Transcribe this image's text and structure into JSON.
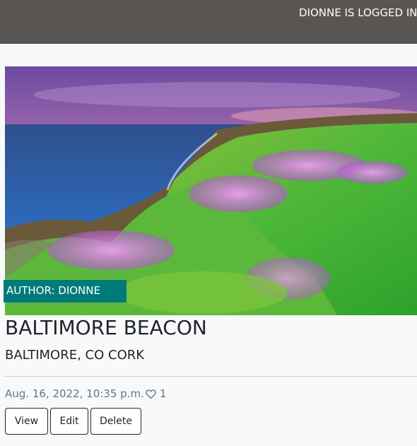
{
  "header": {
    "login_status": "DIONNE IS LOGGED IN"
  },
  "post": {
    "image_alt": "Cliffside with pink wildflowers overlooking the sea at sunset",
    "author_label": "AUTHOR: DIONNE",
    "title": "BALTIMORE BEACON",
    "location": "BALTIMORE, CO CORK",
    "date": "Aug. 16, 2022, 10:35 p.m.",
    "like_icon": "heart-outline",
    "like_count": "1"
  },
  "actions": {
    "view_label": "View",
    "edit_label": "Edit",
    "delete_label": "Delete"
  },
  "colors": {
    "topbar": "#595553",
    "author_badge": "#017b7a",
    "page_background": "#f8f9fa"
  }
}
